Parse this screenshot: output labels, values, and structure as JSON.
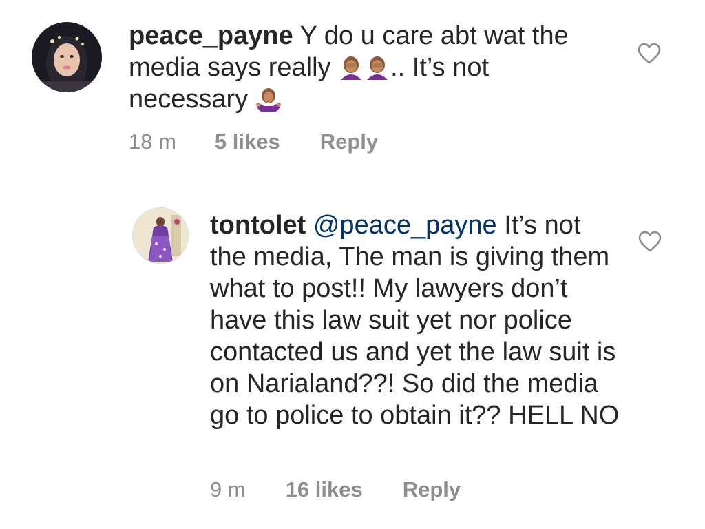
{
  "comments": [
    {
      "username": "peace_payne",
      "text_1": "Y do u care abt wat the media says really",
      "text_2": ".. It’s not necessary",
      "emoji_inline": [
        "woman-facepalming",
        "woman-facepalming"
      ],
      "emoji_end": "woman-shrugging",
      "time": "18 m",
      "likes": "5 likes",
      "reply": "Reply"
    },
    {
      "username": "tontolet",
      "mention": "@peace_payne",
      "text": "It’s not the media, The man is giving them what to post!! My lawyers don’t have this law suit yet nor police contacted us and yet the law suit is on Narialand??! So did the media go to police to obtain it?? HELL NO",
      "time": "9 m",
      "likes": "16 likes",
      "reply": "Reply"
    }
  ],
  "colors": {
    "text": "#262626",
    "meta": "#8e8e8e",
    "mention": "#003569",
    "heart_outline": "#8e8e8e"
  },
  "icons": [
    "heart-outline-icon"
  ]
}
